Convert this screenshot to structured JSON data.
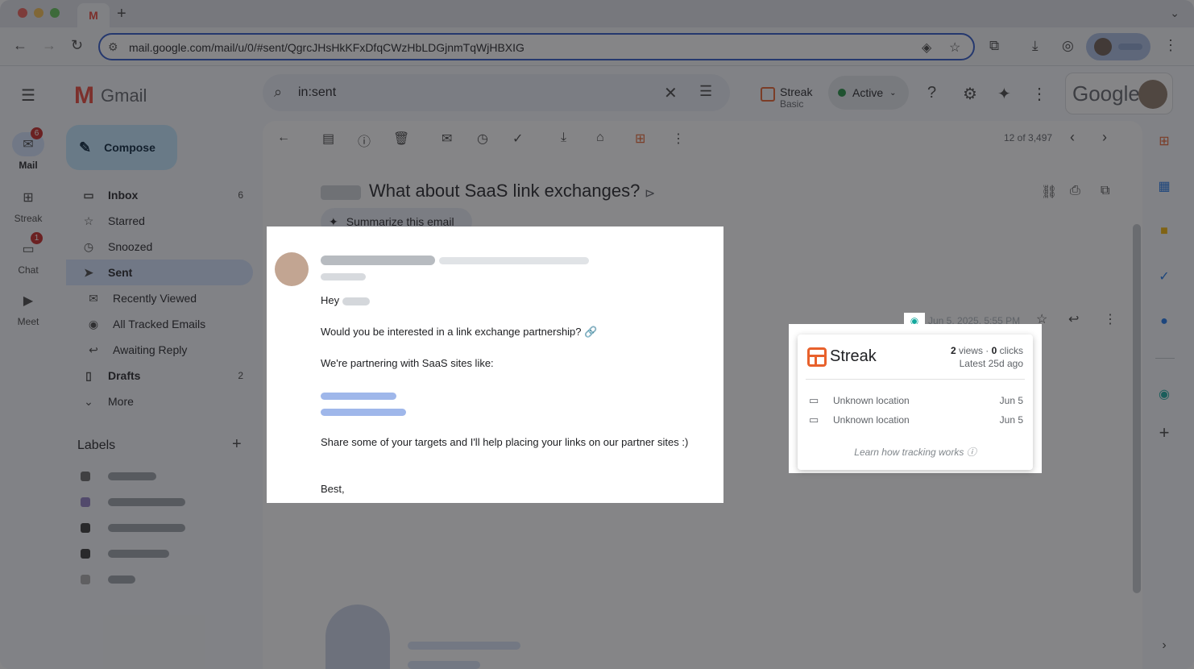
{
  "browser": {
    "tab_favicon": "M",
    "url": "mail.google.com/mail/u/0/#sent/QgrcJHsHkKFxDfqCWzHbLDGjnmTqWjHBXIG"
  },
  "rail": {
    "items": [
      {
        "label": "Mail",
        "badge": "6"
      },
      {
        "label": "Streak",
        "badge": ""
      },
      {
        "label": "Chat",
        "badge": "1"
      },
      {
        "label": "Meet",
        "badge": ""
      }
    ]
  },
  "app": {
    "name": "Gmail",
    "compose_label": "Compose"
  },
  "nav": {
    "items": [
      {
        "label": "Inbox",
        "count": "6"
      },
      {
        "label": "Starred",
        "count": ""
      },
      {
        "label": "Snoozed",
        "count": ""
      },
      {
        "label": "Sent",
        "count": ""
      },
      {
        "label": "Recently Viewed",
        "count": ""
      },
      {
        "label": "All Tracked Emails",
        "count": ""
      },
      {
        "label": "Awaiting Reply",
        "count": ""
      },
      {
        "label": "Drafts",
        "count": "2"
      },
      {
        "label": "More",
        "count": ""
      }
    ],
    "labels_heading": "Labels"
  },
  "search": {
    "value": "in:sent"
  },
  "header": {
    "streak_name": "Streak",
    "streak_plan": "Basic",
    "status": "Active",
    "google_label": "Google"
  },
  "thread": {
    "pager": "12 of 3,497",
    "subject": "What about SaaS link exchanges?",
    "summarize_label": "Summarize this email",
    "date": "Jun 5, 2025, 5:55 PM",
    "body": {
      "greeting": "Hey",
      "line1": "Would you be interested in a link exchange partnership? 🔗",
      "line2": "We're partnering with SaaS sites like:",
      "line3": "Share some of your targets and I'll help placing your links on our partner sites  :)",
      "signoff": "Best,"
    }
  },
  "tracking_popup": {
    "title": "Streak",
    "views": "2",
    "views_label": " views · ",
    "clicks": "0",
    "clicks_label": " clicks",
    "latest": "Latest 25d ago",
    "rows": [
      {
        "location": "Unknown location",
        "date": "Jun 5"
      },
      {
        "location": "Unknown location",
        "date": "Jun 5"
      }
    ],
    "learn_link": "Learn how tracking works"
  },
  "colors": {
    "accent": "#0b57d0",
    "streak_orange": "#e8612c",
    "tracking_eye": "#12a89d",
    "badge_red": "#c5221f"
  }
}
